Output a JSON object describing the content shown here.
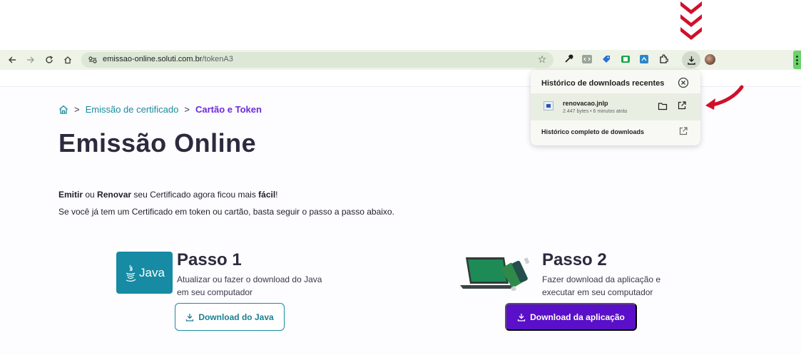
{
  "browser": {
    "url_host": "emissao-online.soluti.com.br",
    "url_path": "/tokenA3",
    "icons": [
      "back-arrow-icon",
      "forward-arrow-icon",
      "reload-icon",
      "home-icon",
      "site-settings-icon",
      "bookmark-star-icon",
      "eyedropper-icon",
      "code-icon",
      "tag-icon",
      "sheet-icon",
      "screenshot-icon",
      "extensions-puzzle-icon",
      "download-icon",
      "profile-avatar",
      "more-menu-icon"
    ]
  },
  "downloads_panel": {
    "title": "Histórico de downloads recentes",
    "item": {
      "name": "renovacao.jnlp",
      "meta": "2.447 bytes • 6 minutos atrás"
    },
    "full_history": "Histórico completo de downloads"
  },
  "breadcrumb": {
    "items": [
      "Emissão de certificado",
      "Cartão e Token"
    ]
  },
  "page": {
    "title": "Emissão Online",
    "intro_line1": {
      "b1": "Emitir",
      "t1": " ou ",
      "b2": "Renovar",
      "t2": " seu Certificado agora ficou mais ",
      "b3": "fácil",
      "t3": "!"
    },
    "intro_line2": "Se você já tem um Certificado em token ou cartão, basta seguir o passo a passo abaixo."
  },
  "steps": [
    {
      "logo_text": "Java",
      "title": "Passo 1",
      "desc_line1": "Atualizar ou fazer o download do Java",
      "desc_line2": "em seu computador",
      "button": "Download do Java"
    },
    {
      "title": "Passo 2",
      "desc_line1": "Fazer download da aplicação e",
      "desc_line2": "executar em seu computador",
      "button": "Download da aplicação"
    }
  ],
  "colors": {
    "teal": "#1a8c9e",
    "purple": "#5a0fc9",
    "annotation_red": "#d0102a"
  }
}
